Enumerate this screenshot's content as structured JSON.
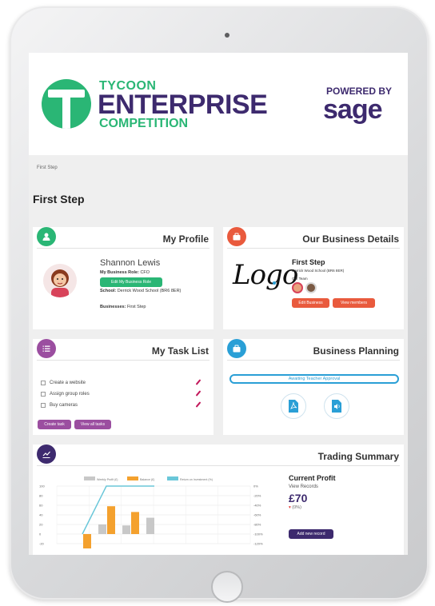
{
  "brand": {
    "line1": "TYCOON",
    "line2": "ENTERPRISE",
    "line3": "COMPETITION",
    "powered": "POWERED BY",
    "sage": "sage"
  },
  "breadcrumb": "First Step",
  "page_title": "First Step",
  "profile": {
    "title": "My Profile",
    "name": "Shannon Lewis",
    "role_label": "My Business Role:",
    "role_value": "CFO",
    "edit_button": "Edit My Business Role",
    "school_label": "School:",
    "school_value": "Derrick Wood School (BR6 8ER)",
    "businesses_label": "Businesses:",
    "businesses_value": "First Step"
  },
  "business": {
    "title": "Our Business Details",
    "logo_text": "Logo",
    "name": "First Step",
    "school": "Derrick Wood School (BR6 8ER)",
    "team_label": "Our Team",
    "edit_button": "Edit Business",
    "members_button": "View members"
  },
  "tasks": {
    "title": "My Task List",
    "items": [
      "Create a website",
      "Assign group roles",
      "Buy cameras"
    ],
    "create_button": "Create task",
    "view_button": "View all tasks"
  },
  "planning": {
    "title": "Business Planning",
    "status": "Awaiting Teacher Approval"
  },
  "trading": {
    "title": "Trading Summary",
    "current_profit_label": "Current Profit",
    "view_records": "View Records",
    "profit_value": "£70",
    "profit_change": "(0%)",
    "add_record_button": "Add new record"
  },
  "colors": {
    "green": "#2ab675",
    "purple": "#3d2a6e",
    "profile": "#2ab675",
    "business": "#e95a3d",
    "tasks": "#9b4ea0",
    "planning": "#2a9fd6",
    "trading": "#3d2a6e",
    "orange": "#f4a12e",
    "grey": "#c8c8c8",
    "teal": "#6ac7d9"
  },
  "icons": {
    "profile": "user-icon",
    "business": "briefcase-icon",
    "tasks": "list-icon",
    "planning": "folder-icon",
    "trading": "chart-icon"
  },
  "chart_data": {
    "type": "bar",
    "series": [
      {
        "name": "Weekly Profit (£)",
        "values": [
          0,
          20,
          18,
          34
        ],
        "color": "#c8c8c8"
      },
      {
        "name": "Balance (£)",
        "values": [
          -30,
          58,
          46,
          0
        ],
        "color": "#f4a12e"
      },
      {
        "name": "Return on Investment (%)",
        "values": [
          -100,
          0,
          0,
          0
        ],
        "color": "#6ac7d9"
      }
    ],
    "ylabels_left": [
      "100",
      "80",
      "60",
      "40",
      "20",
      "0",
      "-20"
    ],
    "ylabels_right": [
      "0%",
      "-20%",
      "-40%",
      "-60%",
      "-80%",
      "-100%",
      "-120%"
    ],
    "ylim": [
      -20,
      100
    ],
    "legend": "top"
  }
}
